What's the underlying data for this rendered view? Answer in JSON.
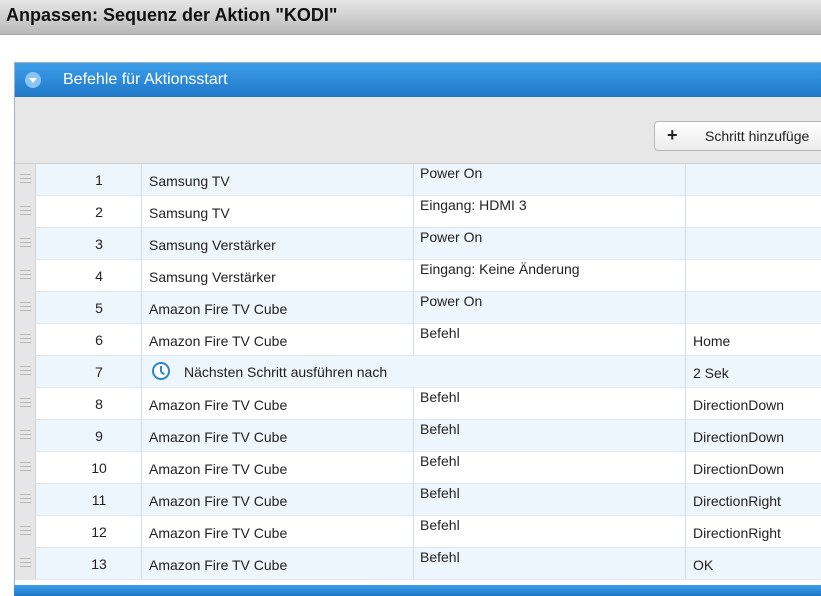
{
  "window": {
    "title": "Anpassen: Sequenz der Aktion \"KODI\""
  },
  "panel": {
    "title": "Befehle für Aktionsstart",
    "add_step_label": "Schritt hinzufüge"
  },
  "steps": [
    {
      "num": "1",
      "device": "Samsung TV",
      "command": "Power On",
      "value": ""
    },
    {
      "num": "2",
      "device": "Samsung TV",
      "command": "Eingang: HDMI 3",
      "value": ""
    },
    {
      "num": "3",
      "device": "Samsung Verstärker",
      "command": "Power On",
      "value": ""
    },
    {
      "num": "4",
      "device": "Samsung Verstärker",
      "command": "Eingang: Keine Änderung",
      "value": ""
    },
    {
      "num": "5",
      "device": "Amazon Fire TV Cube",
      "command": "Power On",
      "value": ""
    },
    {
      "num": "6",
      "device": "Amazon Fire TV Cube",
      "command": "Befehl",
      "value": "Home"
    },
    {
      "num": "7",
      "wait_label": "Nächsten Schritt ausführen nach",
      "value": "2 Sek"
    },
    {
      "num": "8",
      "device": "Amazon Fire TV Cube",
      "command": "Befehl",
      "value": "DirectionDown"
    },
    {
      "num": "9",
      "device": "Amazon Fire TV Cube",
      "command": "Befehl",
      "value": "DirectionDown"
    },
    {
      "num": "10",
      "device": "Amazon Fire TV Cube",
      "command": "Befehl",
      "value": "DirectionDown"
    },
    {
      "num": "11",
      "device": "Amazon Fire TV Cube",
      "command": "Befehl",
      "value": "DirectionRight"
    },
    {
      "num": "12",
      "device": "Amazon Fire TV Cube",
      "command": "Befehl",
      "value": "DirectionRight"
    },
    {
      "num": "13",
      "device": "Amazon Fire TV Cube",
      "command": "Befehl",
      "value": "OK"
    }
  ],
  "colors": {
    "header_blue": "#1f78c8",
    "row_alt": "#eef6fd",
    "clock_icon": "#2c86c8"
  },
  "icons": {
    "collapse": "chevron-down-icon",
    "add": "plus-icon",
    "drag": "drag-handle-icon",
    "wait": "clock-icon"
  }
}
